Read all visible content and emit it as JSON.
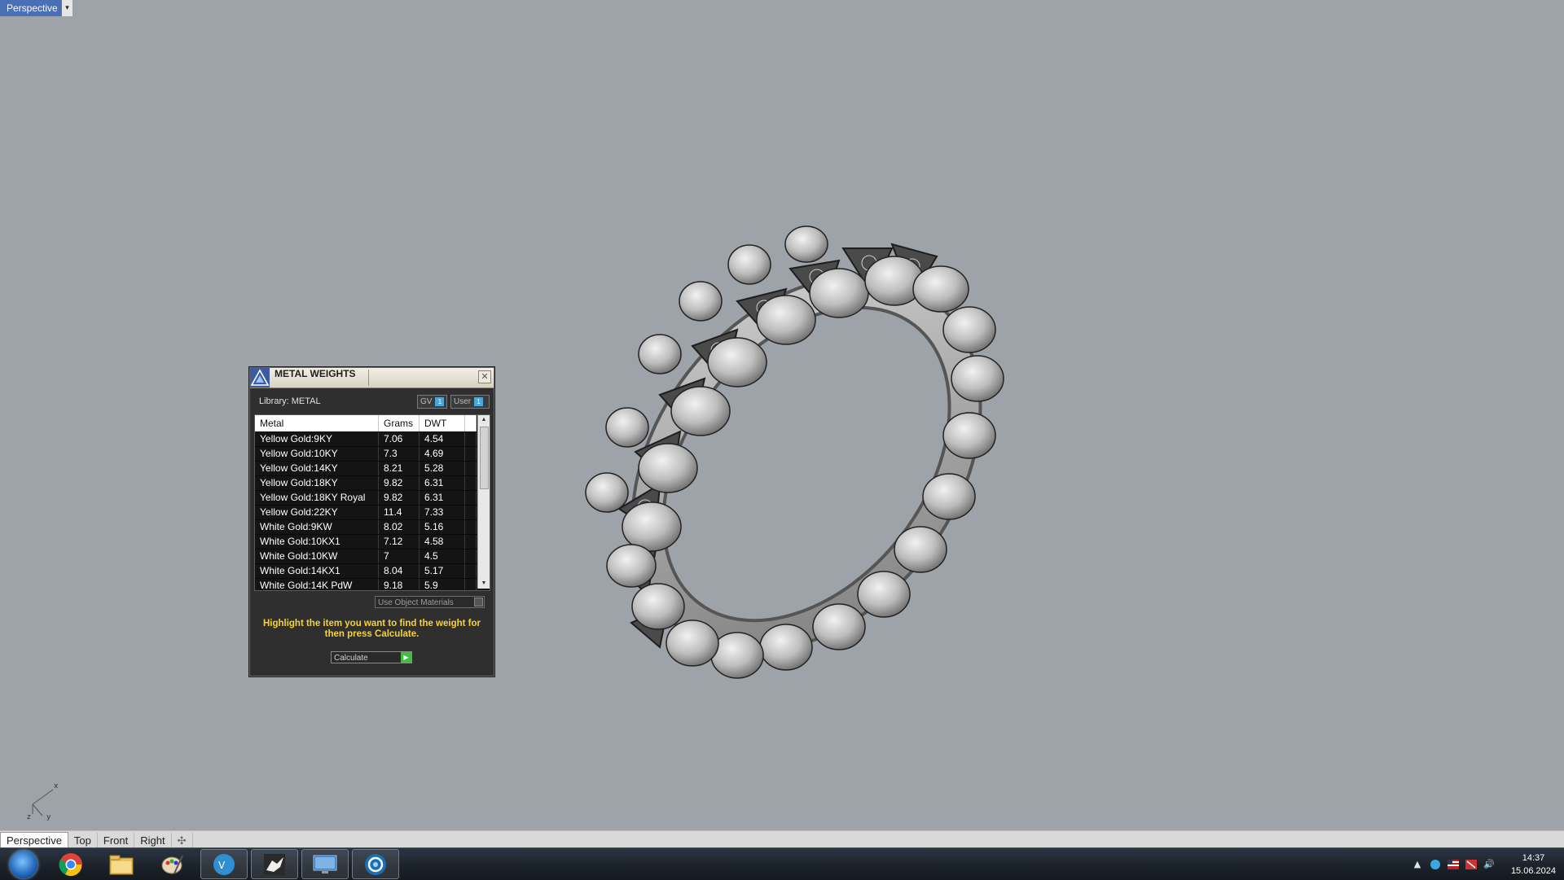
{
  "viewport": {
    "title": "Perspective",
    "axis": {
      "x": "x",
      "y": "y",
      "z": "z"
    }
  },
  "viewport_tabs": [
    {
      "label": "Perspective",
      "active": true
    },
    {
      "label": "Top",
      "active": false
    },
    {
      "label": "Front",
      "active": false
    },
    {
      "label": "Right",
      "active": false
    }
  ],
  "add_tab_icon": "plus-icon",
  "dialog": {
    "title": "METAL WEIGHTS",
    "library_label": "Library: METAL",
    "chip_gv": "GV",
    "chip_user": "User",
    "chip_value": "1",
    "columns": [
      "Metal",
      "Grams",
      "DWT"
    ],
    "rows": [
      [
        "Yellow Gold:9KY",
        "7.06",
        "4.54"
      ],
      [
        "Yellow Gold:10KY",
        "7.3",
        "4.69"
      ],
      [
        "Yellow Gold:14KY",
        "8.21",
        "5.28"
      ],
      [
        "Yellow Gold:18KY",
        "9.82",
        "6.31"
      ],
      [
        "Yellow Gold:18KY Royal",
        "9.82",
        "6.31"
      ],
      [
        "Yellow Gold:22KY",
        "11.4",
        "7.33"
      ],
      [
        "White Gold:9KW",
        "8.02",
        "5.16"
      ],
      [
        "White Gold:10KX1",
        "7.12",
        "4.58"
      ],
      [
        "White Gold:10KW",
        "7",
        "4.5"
      ],
      [
        "White Gold:14KX1",
        "8.04",
        "5.17"
      ],
      [
        "White Gold:14K PdW",
        "9.18",
        "5.9"
      ]
    ],
    "use_object_materials": "Use Object Materials",
    "hint": "Highlight the item you want to find the weight for then press Calculate.",
    "calculate_label": "Calculate"
  },
  "taskbar": {
    "apps": [
      "start-orb",
      "chrome-icon",
      "file-explorer-icon",
      "paint-icon",
      "vray-icon",
      "rhino-icon",
      "remote-desktop-icon",
      "app-icon"
    ]
  },
  "clock": {
    "time": "14:37",
    "date": "15.06.2024"
  },
  "colors": {
    "accent_tab": "#4a6fb5",
    "hint_text": "#f5d23c",
    "viewport_bg": "#9ea3aa"
  }
}
